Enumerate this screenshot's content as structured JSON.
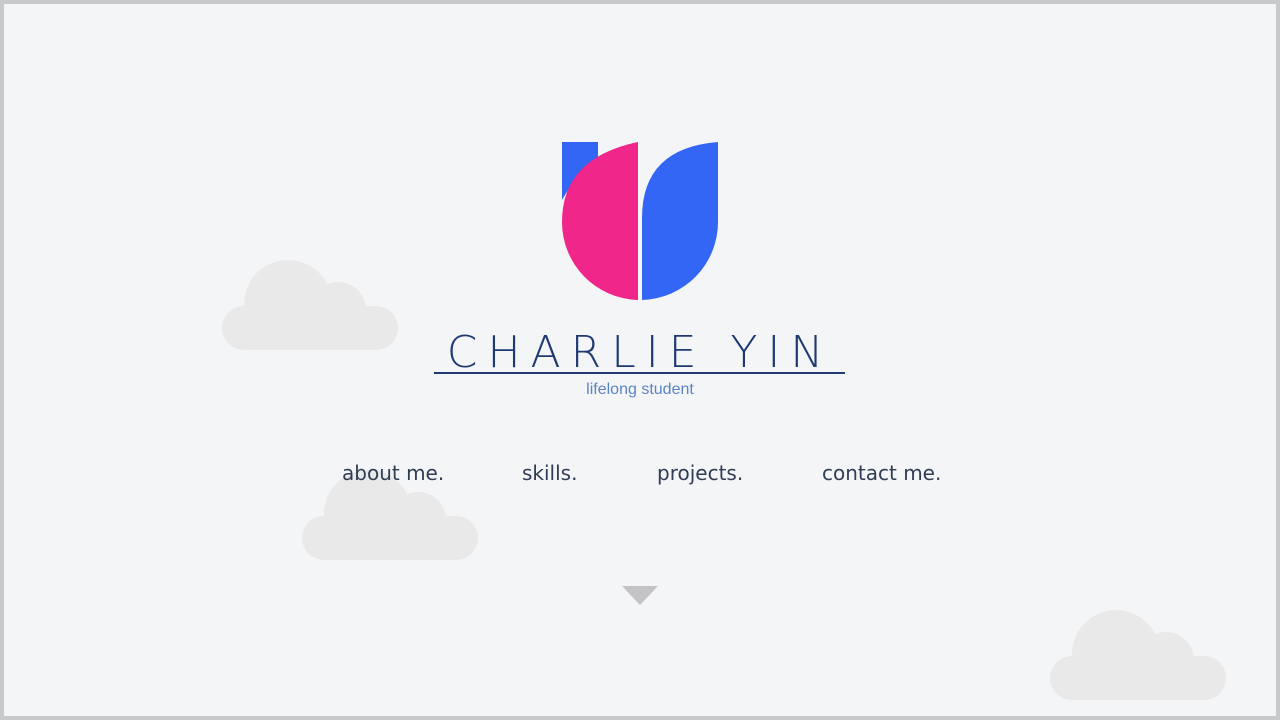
{
  "brand": {
    "name": "CHARLIE YIN",
    "tagline": "lifelong student",
    "logo_icon": "tulip-logo-icon",
    "colors": {
      "pink": "#f0268a",
      "blue": "#3366f5",
      "name": "#1f3a73",
      "tagline": "#5b84c4"
    }
  },
  "nav": {
    "items": [
      {
        "label": "about me."
      },
      {
        "label": "skills."
      },
      {
        "label": "projects."
      },
      {
        "label": "contact me."
      }
    ],
    "color": "#2f3d55"
  },
  "scroll_indicator": {
    "icon": "chevron-down-icon",
    "color": "#c4c4c6"
  },
  "background": {
    "color": "#f4f5f7",
    "cloud_color": "#e9e9ea",
    "decoration_icon": "cloud-icon"
  }
}
